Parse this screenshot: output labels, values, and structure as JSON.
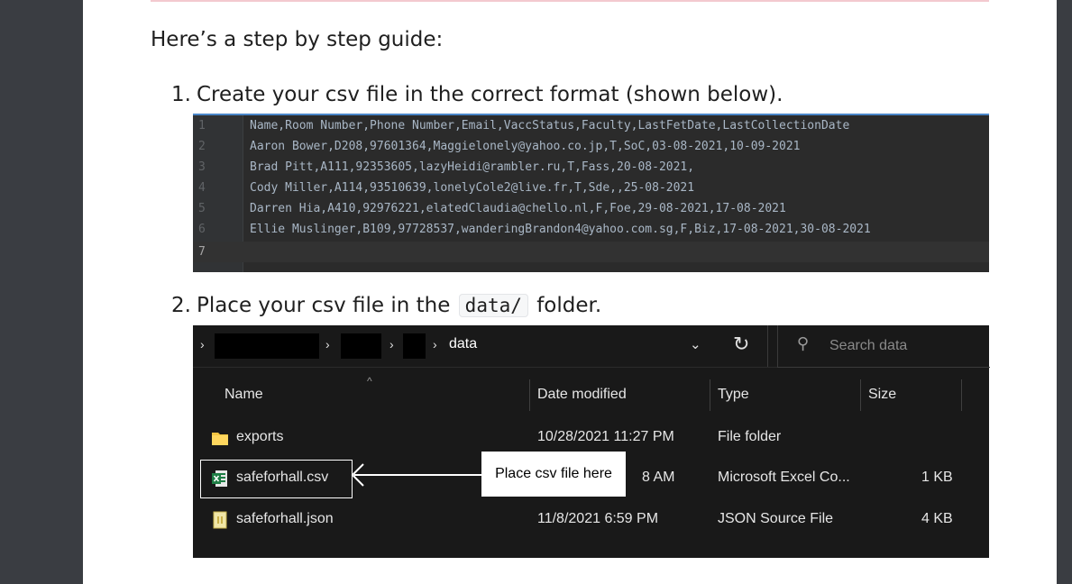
{
  "intro": "Here’s a step by step guide:",
  "steps": [
    {
      "num": "1.",
      "text": "Create your csv file in the correct format (shown below)."
    },
    {
      "num": "2.",
      "before": "Place your csv file in the",
      "code": "data/",
      "after": "folder."
    }
  ],
  "csv": {
    "line_numbers": [
      "1",
      "2",
      "3",
      "4",
      "5",
      "6",
      "7"
    ],
    "lines": [
      "Name,Room Number,Phone Number,Email,VaccStatus,Faculty,LastFetDate,LastCollectionDate",
      "Aaron Bower,D208,97601364,Maggielonely@yahoo.co.jp,T,SoC,03-08-2021,10-09-2021",
      "Brad Pitt,A111,92353605,lazyHeidi@rambler.ru,T,Fass,20-08-2021,",
      "Cody Miller,A114,93510639,lonelyCole2@live.fr,T,Sde,,25-08-2021",
      "Darren Hia,A410,92976221,elatedClaudia@chello.nl,F,Foe,29-08-2021,17-08-2021",
      "Ellie Muslinger,B109,97728537,wanderingBrandon4@yahoo.com.sg,F,Biz,17-08-2021,30-08-2021",
      ""
    ]
  },
  "explorer": {
    "breadcrumb_folder": "data",
    "search_placeholder": "Search data",
    "columns": [
      "Name",
      "Date modified",
      "Type",
      "Size"
    ],
    "rows": [
      {
        "icon": "folder-icon",
        "name": "exports",
        "date": "10/28/2021 11:27 PM",
        "type": "File folder",
        "size": ""
      },
      {
        "icon": "excel-file-icon",
        "name": "safeforhall.csv",
        "date": "8 AM",
        "type": "Microsoft Excel Co...",
        "size": "1 KB"
      },
      {
        "icon": "json-file-icon",
        "name": "safeforhall.json",
        "date": "11/8/2021 6:59 PM",
        "type": "JSON Source File",
        "size": "4 KB"
      }
    ],
    "annotation": "Place csv file here"
  },
  "colors": {
    "editor_bg": "#2b2b2b",
    "explorer_bg": "#191919",
    "folder": "#f4c542",
    "excel": "#1e7e45"
  }
}
